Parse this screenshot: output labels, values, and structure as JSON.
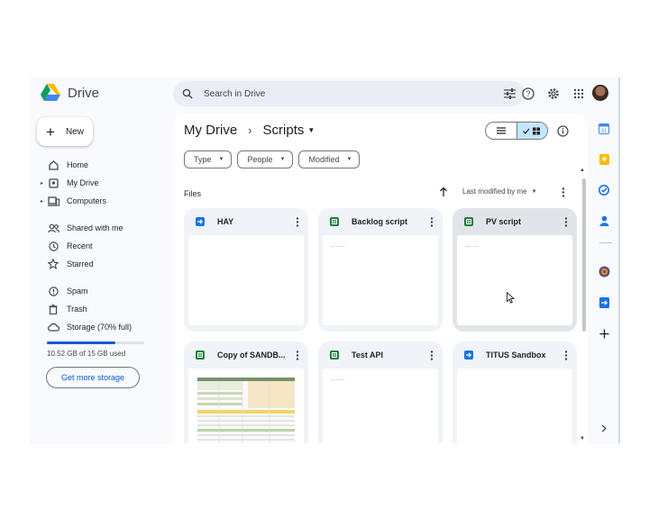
{
  "app": {
    "name": "Drive"
  },
  "search": {
    "placeholder": "Search in Drive"
  },
  "top_icons": [
    "search-options-icon",
    "help-icon",
    "settings-icon",
    "apps-grid-icon"
  ],
  "new_button": {
    "label": "New"
  },
  "nav": [
    {
      "label": "Home",
      "icon": "home-icon"
    },
    {
      "label": "My Drive",
      "icon": "my-drive-icon",
      "expandable": true
    },
    {
      "label": "Computers",
      "icon": "computers-icon",
      "expandable": true
    },
    {
      "label": "Shared with me",
      "icon": "shared-icon"
    },
    {
      "label": "Recent",
      "icon": "recent-icon"
    },
    {
      "label": "Starred",
      "icon": "star-icon"
    },
    {
      "label": "Spam",
      "icon": "spam-icon"
    },
    {
      "label": "Trash",
      "icon": "trash-icon"
    },
    {
      "label": "Storage (70% full)",
      "icon": "cloud-icon"
    }
  ],
  "storage": {
    "used_text": "10.52 GB of 15 GB used",
    "fraction": 0.7,
    "more_label": "Get more storage"
  },
  "breadcrumb": {
    "root": "My Drive",
    "current": "Scripts"
  },
  "filters": [
    "Type",
    "People",
    "Modified"
  ],
  "files": {
    "section_label": "Files",
    "sort_label": "Last modified by me",
    "items": [
      {
        "name": "HAY",
        "type": "apps-script",
        "color": "#1a73e8"
      },
      {
        "name": "Backlog script",
        "type": "sheets",
        "color": "#188038"
      },
      {
        "name": "PV script",
        "type": "sheets",
        "color": "#188038",
        "active": true
      },
      {
        "name": "Copy of SANDB...",
        "type": "sheets",
        "color": "#188038"
      },
      {
        "name": "Test API",
        "type": "sheets",
        "color": "#188038"
      },
      {
        "name": "TITUS Sandbox",
        "type": "apps-script",
        "color": "#1a73e8"
      }
    ]
  },
  "rail_icons": [
    "calendar-icon",
    "keep-icon",
    "tasks-icon",
    "contacts-icon",
    "addon-icon",
    "apps-script-addon-icon",
    "add-icon"
  ],
  "colors": {
    "accent": "#0b57d0",
    "selected": "#c2e7ff"
  }
}
